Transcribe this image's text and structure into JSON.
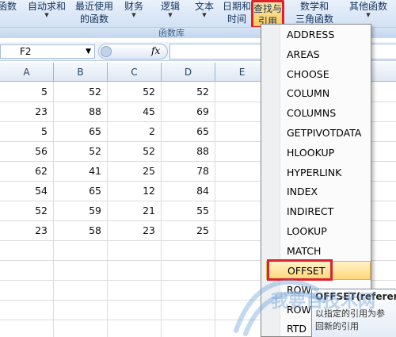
{
  "ribbon": {
    "buttons": [
      {
        "line1": "函数",
        "line2": ""
      },
      {
        "line1": "自动求和",
        "line2": ""
      },
      {
        "line1": "最近使用",
        "line2": "的函数"
      },
      {
        "line1": "财务",
        "line2": ""
      },
      {
        "line1": "逻辑",
        "line2": ""
      },
      {
        "line1": "文本",
        "line2": ""
      },
      {
        "line1": "日期和",
        "line2": "时间"
      },
      {
        "line1": "查找与",
        "line2": "引用"
      },
      {
        "line1": "数学和",
        "line2": "三角函数"
      },
      {
        "line1": "其他函数",
        "line2": ""
      }
    ],
    "group_label": "函数库"
  },
  "formula_bar": {
    "name_box": "F2",
    "fx_label": "fx"
  },
  "columns": [
    "A",
    "B",
    "C",
    "D",
    "E"
  ],
  "rows": [
    [
      "5",
      "52",
      "52",
      "52"
    ],
    [
      "23",
      "88",
      "45",
      "69"
    ],
    [
      "5",
      "65",
      "2",
      "65"
    ],
    [
      "56",
      "52",
      "52",
      "88"
    ],
    [
      "62",
      "41",
      "25",
      "78"
    ],
    [
      "54",
      "65",
      "12",
      "84"
    ],
    [
      "52",
      "59",
      "21",
      "55"
    ],
    [
      "23",
      "58",
      "23",
      "25"
    ]
  ],
  "menu": {
    "items": [
      "ADDRESS",
      "AREAS",
      "CHOOSE",
      "COLUMN",
      "COLUMNS",
      "GETPIVOTDATA",
      "HLOOKUP",
      "HYPERLINK",
      "INDEX",
      "INDIRECT",
      "LOOKUP",
      "MATCH",
      "OFFSET",
      "ROW",
      "ROWS",
      "RTD"
    ],
    "selected": "OFFSET"
  },
  "tooltip": {
    "title": "OFFSET(referen",
    "line1": "以指定的引用为参",
    "line2": "回新的引用"
  },
  "watermark": {
    "text": "我要百技术网"
  },
  "colors": {
    "highlight_red": "#e0202a",
    "menu_selected": "#ffd77a"
  }
}
